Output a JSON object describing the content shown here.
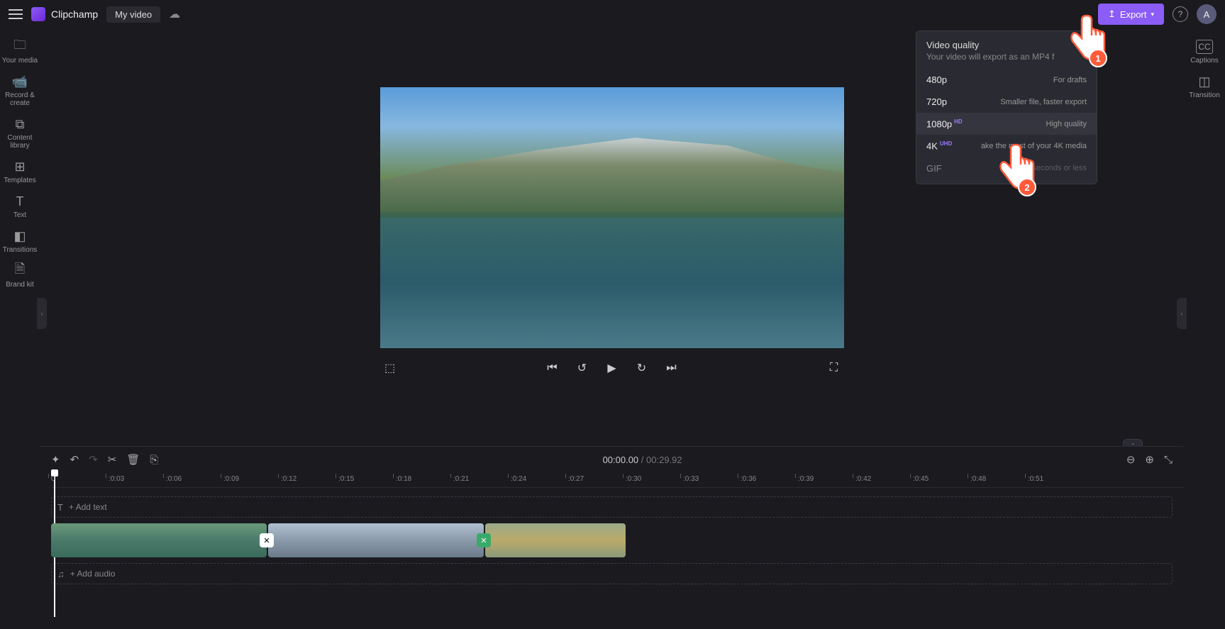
{
  "app": {
    "name": "Clipchamp",
    "title": "My video",
    "avatar": "A"
  },
  "export": {
    "label": "Export"
  },
  "leftbar": [
    {
      "label": "Your media",
      "icon": "🗀"
    },
    {
      "label": "Record & create",
      "icon": "⏺"
    },
    {
      "label": "Content library",
      "icon": "⧉"
    },
    {
      "label": "Templates",
      "icon": "⊞"
    },
    {
      "label": "Text",
      "icon": "T"
    },
    {
      "label": "Transitions",
      "icon": "◧"
    },
    {
      "label": "Brand kit",
      "icon": "☰"
    }
  ],
  "rightbar": [
    {
      "label": "Captions",
      "icon": "CC"
    },
    {
      "label": "Transition",
      "icon": "◫"
    }
  ],
  "time": {
    "current": "00:00.00",
    "duration": "00:29.92"
  },
  "ruler": [
    "0",
    ":0:03",
    ":0:06",
    ":0:09",
    ":0:12",
    ":0:15",
    ":0:18",
    ":0:21",
    ":0:24",
    ":0:27",
    ":0:30",
    ":0:33",
    ":0:36",
    ":0:39",
    ":0:42",
    ":0:45",
    ":0:48",
    ":0:51"
  ],
  "tracks": {
    "text": "+ Add text",
    "audio": "+ Add audio"
  },
  "export_menu": {
    "title": "Video quality",
    "subtitle": "Your video will export as an MP4 f",
    "items": [
      {
        "res": "480p",
        "badge": "",
        "desc": "For drafts",
        "state": ""
      },
      {
        "res": "720p",
        "badge": "",
        "desc": "Smaller file, faster export",
        "state": ""
      },
      {
        "res": "1080p",
        "badge": "HD",
        "desc": "High quality",
        "state": "hover"
      },
      {
        "res": "4K",
        "badge": "UHD",
        "desc": "ake the most of your 4K media",
        "state": ""
      },
      {
        "res": "GIF",
        "badge": "",
        "desc": "os 15 seconds or less",
        "state": "disabled"
      }
    ]
  },
  "hands": {
    "one": "1",
    "two": "2"
  }
}
